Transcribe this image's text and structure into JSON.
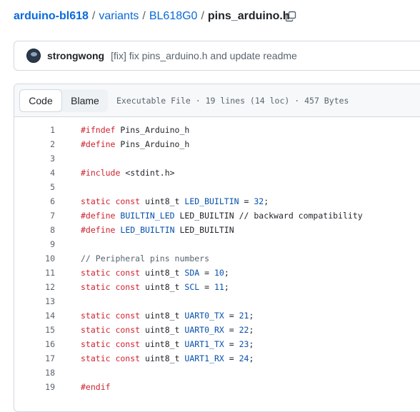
{
  "breadcrumb": {
    "repo": "arduino-bl618",
    "sep1": "/",
    "dir1": "variants",
    "sep2": "/",
    "dir2": "BL618G0",
    "sep3": "/",
    "file": "pins_arduino.h",
    "copy_icon": "copy-icon"
  },
  "commit": {
    "author": "strongwong",
    "message": "[fix] fix pins_arduino.h and update readme"
  },
  "file_header": {
    "tabs": [
      "Code",
      "Blame"
    ],
    "active_tab": "Code",
    "meta": "Executable File · 19 lines (14 loc) · 457 Bytes"
  },
  "code": {
    "lines": [
      {
        "n": "1",
        "segs": [
          {
            "t": "#ifndef ",
            "c": "kw"
          },
          {
            "t": "Pins_Arduino_h",
            "c": ""
          }
        ]
      },
      {
        "n": "2",
        "segs": [
          {
            "t": "#define ",
            "c": "kw"
          },
          {
            "t": "Pins_Arduino_h",
            "c": ""
          }
        ]
      },
      {
        "n": "3",
        "segs": []
      },
      {
        "n": "4",
        "segs": [
          {
            "t": "#include ",
            "c": "kw"
          },
          {
            "t": "<stdint.h>",
            "c": ""
          }
        ]
      },
      {
        "n": "5",
        "segs": []
      },
      {
        "n": "6",
        "segs": [
          {
            "t": "static const ",
            "c": "kw"
          },
          {
            "t": "uint8_t ",
            "c": ""
          },
          {
            "t": "LED_BUILTIN",
            "c": "tp"
          },
          {
            "t": " = ",
            "c": ""
          },
          {
            "t": "32",
            "c": "tp"
          },
          {
            "t": ";",
            "c": ""
          }
        ]
      },
      {
        "n": "7",
        "segs": [
          {
            "t": "#define ",
            "c": "kw"
          },
          {
            "t": "BUILTIN_LED ",
            "c": "tp"
          },
          {
            "t": "LED_BUILTIN ",
            "c": ""
          },
          {
            "t": "// backward compatibility",
            "c": ""
          }
        ]
      },
      {
        "n": "8",
        "segs": [
          {
            "t": "#define ",
            "c": "kw"
          },
          {
            "t": "LED_BUILTIN ",
            "c": "tp"
          },
          {
            "t": "LED_BUILTIN",
            "c": ""
          }
        ]
      },
      {
        "n": "9",
        "segs": []
      },
      {
        "n": "10",
        "segs": [
          {
            "t": "// Peripheral pins numbers",
            "c": "cm"
          }
        ]
      },
      {
        "n": "11",
        "segs": [
          {
            "t": "static const ",
            "c": "kw"
          },
          {
            "t": "uint8_t ",
            "c": ""
          },
          {
            "t": "SDA",
            "c": "tp"
          },
          {
            "t": " = ",
            "c": ""
          },
          {
            "t": "10",
            "c": "tp"
          },
          {
            "t": ";",
            "c": ""
          }
        ]
      },
      {
        "n": "12",
        "segs": [
          {
            "t": "static const ",
            "c": "kw"
          },
          {
            "t": "uint8_t ",
            "c": ""
          },
          {
            "t": "SCL",
            "c": "tp"
          },
          {
            "t": " = ",
            "c": ""
          },
          {
            "t": "11",
            "c": "tp"
          },
          {
            "t": ";",
            "c": ""
          }
        ]
      },
      {
        "n": "13",
        "segs": []
      },
      {
        "n": "14",
        "segs": [
          {
            "t": "static const ",
            "c": "kw"
          },
          {
            "t": "uint8_t ",
            "c": ""
          },
          {
            "t": "UART0_TX",
            "c": "tp"
          },
          {
            "t": " = ",
            "c": ""
          },
          {
            "t": "21",
            "c": "tp"
          },
          {
            "t": ";",
            "c": ""
          }
        ]
      },
      {
        "n": "15",
        "segs": [
          {
            "t": "static const ",
            "c": "kw"
          },
          {
            "t": "uint8_t ",
            "c": ""
          },
          {
            "t": "UART0_RX",
            "c": "tp"
          },
          {
            "t": " = ",
            "c": ""
          },
          {
            "t": "22",
            "c": "tp"
          },
          {
            "t": ";",
            "c": ""
          }
        ]
      },
      {
        "n": "16",
        "segs": [
          {
            "t": "static const ",
            "c": "kw"
          },
          {
            "t": "uint8_t ",
            "c": ""
          },
          {
            "t": "UART1_TX",
            "c": "tp"
          },
          {
            "t": " = ",
            "c": ""
          },
          {
            "t": "23",
            "c": "tp"
          },
          {
            "t": ";",
            "c": ""
          }
        ]
      },
      {
        "n": "17",
        "segs": [
          {
            "t": "static const ",
            "c": "kw"
          },
          {
            "t": "uint8_t ",
            "c": ""
          },
          {
            "t": "UART1_RX",
            "c": "tp"
          },
          {
            "t": " = ",
            "c": ""
          },
          {
            "t": "24",
            "c": "tp"
          },
          {
            "t": ";",
            "c": ""
          }
        ]
      },
      {
        "n": "18",
        "segs": []
      },
      {
        "n": "19",
        "segs": [
          {
            "t": "#endif",
            "c": "kw"
          }
        ]
      }
    ]
  },
  "colors": {
    "link": "#0969da",
    "keyword": "#cf222e",
    "entity": "#0550ae",
    "muted": "#59636e"
  }
}
